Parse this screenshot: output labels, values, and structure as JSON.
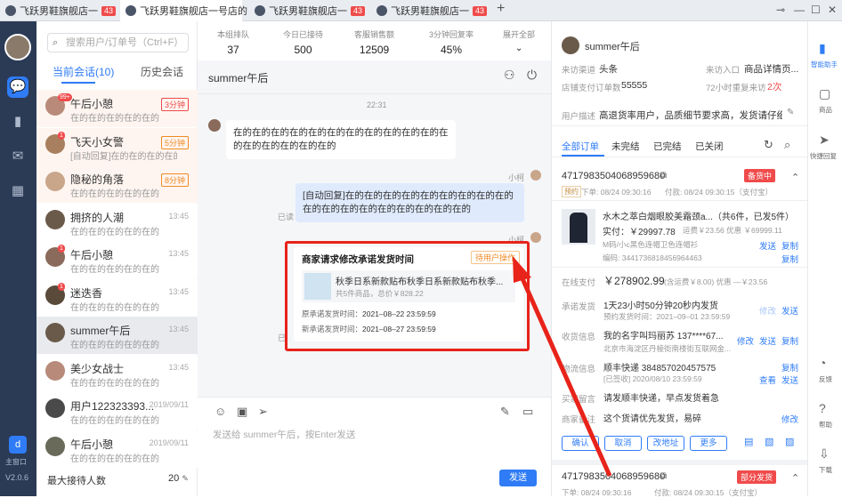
{
  "tabs": [
    {
      "label": "飞跃男鞋旗舰店一",
      "badge": "43"
    },
    {
      "label": "飞跃男鞋旗舰店一号店的"
    },
    {
      "label": "飞跃男鞋旗舰店一",
      "badge": "43"
    },
    {
      "label": "飞跃男鞋旗舰店一",
      "badge": "43"
    }
  ],
  "add_tab": "+",
  "window_controls": {
    "pin": "⊸",
    "minimize": "—",
    "maximize": "☐",
    "close": "✕"
  },
  "rail": {
    "main_label": "主窗口",
    "version": "V2.0.6"
  },
  "search": {
    "placeholder": "搜索用户/订单号（Ctrl+F）"
  },
  "conv_tabs": {
    "current": "当前会话(10)",
    "history": "历史会话"
  },
  "conversations": [
    {
      "name": "午后小憩",
      "msg": "在的在的在的在的在的",
      "time": "3分钟",
      "badge": "99+",
      "bg": "#fff5f0",
      "tcolor": "#f04b4b"
    },
    {
      "name": "飞天小女警",
      "msg": "[自动回复]在的在的在的在的",
      "time": "5分钟",
      "badge": "1",
      "bg": "#fff5f0",
      "tcolor": "#f08a24"
    },
    {
      "name": "隐秘的角落",
      "msg": "在的在的在的在的在的",
      "time": "8分钟",
      "badge": "",
      "bg": "#fff5f0",
      "tcolor": "#f08a24"
    },
    {
      "name": "拥挤的人潮",
      "msg": "在的在的在的在的在的",
      "time": "13:45",
      "badge": "",
      "bg": "#fff",
      "tcolor": ""
    },
    {
      "name": "午后小憩",
      "msg": "在的在的在的在的在的",
      "time": "13:45",
      "badge": "1",
      "bg": "#fff",
      "tcolor": ""
    },
    {
      "name": "迷迭香",
      "msg": "在的在的在的在的在的",
      "time": "13:45",
      "badge": "1",
      "bg": "#fff",
      "tcolor": ""
    },
    {
      "name": "summer午后",
      "msg": "在的在的在的在的在的",
      "time": "13:45",
      "badge": "",
      "bg": "#e8eaee",
      "tcolor": ""
    },
    {
      "name": "美少女战士",
      "msg": "在的在的在的在的在的",
      "time": "13:45",
      "badge": "",
      "bg": "#fff",
      "tcolor": ""
    },
    {
      "name": "用户122323393...",
      "msg": "在的在的在的在的在的",
      "time": "2019/09/11",
      "badge": "",
      "bg": "#fff",
      "tcolor": ""
    },
    {
      "name": "午后小憩",
      "msg": "在的在的在的在的在的",
      "time": "2019/09/11",
      "badge": "",
      "bg": "#fff",
      "tcolor": ""
    }
  ],
  "max_receive": {
    "label": "最大接待人数",
    "value": "20"
  },
  "stats": [
    {
      "label": "本组排队",
      "value": "37"
    },
    {
      "label": "今日已接待",
      "value": "500"
    },
    {
      "label": "客服销售额",
      "value": "12509"
    },
    {
      "label": "3分钟回复率",
      "value": "45%"
    }
  ],
  "expand_all": "展开全部",
  "chat": {
    "title": "summer午后",
    "time": "22:31",
    "msg_in": "在的在的在的在的在的在的在的在的在的在的在的在的在的在的在的在的在的",
    "sender1": "小柯",
    "msg_out": "[自动回复]在的在的在的在的在的在的在的在的在的在的在的在的在的在的在的在的在的在的",
    "read": "已读",
    "sender2": "小柯",
    "read2": "已",
    "card": {
      "title": "商家请求修改承诺发货时间",
      "status": "待用户操作",
      "product": "秋季日系新款贴布秋季日系新款贴布秋季...",
      "summary": "共5件商品，总价￥828.22",
      "orig_label": "原承诺发货时间：",
      "orig_value": "2021–08–22 23:59:59",
      "new_label": "新承诺发货时间：",
      "new_value": "2021–08–27 23:59:59"
    },
    "input_placeholder": "发送给 summer午后，按Enter发送",
    "send": "发送"
  },
  "customer": {
    "name": "summer午后",
    "source_label": "来访渠道",
    "source": "头条",
    "entry_label": "来访入口",
    "entry": "商品详情页...",
    "paid_label": "店铺支付订单数",
    "paid": "55555",
    "repeat_label": "72小时重复来访",
    "repeat": "2次",
    "desc_label": "用户描述",
    "desc": "高退货率用户，品质细节要求高，发货请仔细..."
  },
  "order_tabs": [
    "全部订单",
    "未完结",
    "已完结",
    "已关闭"
  ],
  "order": {
    "id": "4717983504068959680",
    "status": "备货中",
    "prepay": "预约",
    "order_time": "下单: 08/24 09:30:16",
    "pay_time": "付款: 08/24 09:30:15（支付宝）",
    "product": "水木之萃白烟眼胶美霜颈a...",
    "qty": "（共6件，已发5件）",
    "actual": "实付：￥29997.78",
    "actual_extra": "运费￥23.56 优惠 ￥69999.11",
    "sku": "M码/小c黑色连帽卫色连帽衫",
    "code": "编码: 3441736818456964463",
    "send": "发送",
    "copy": "复制",
    "online_label": "在线支付",
    "online": "￥278902.99",
    "online_extra": "(含运费￥8.00)  优惠 —￥23.56",
    "promise_label": "承诺发货",
    "promise": "1天23小时50分钟20秒内发货",
    "promise_sub": "预约发货时间：2021–09–01 23:59:59",
    "modify": "修改",
    "recv_label": "收货信息",
    "recv": "我的名字叫玛丽苏  137****67...",
    "recv_addr": "北京市海淀区丹棱街南楼街互联网金...",
    "view": "查看",
    "ship_label": "物流信息",
    "ship": "顺丰快递  384857020457575",
    "ship_sub": "[已签收] 2020/08/10 23:59:59",
    "buyer_label": "买家留言",
    "buyer": "请发顺丰快递，早点发货着急",
    "merch_label": "商家备注",
    "merch": "这个货请优先发货，易碎",
    "buttons": [
      "确认",
      "取消",
      "改地址",
      "更多"
    ]
  },
  "order2": {
    "id": "4717983504068959680",
    "status": "部分发货",
    "order_time": "下单: 08/24 09:30:16",
    "pay_time": "付款: 08/24 09:30:15（支付宝）"
  },
  "right_nav": {
    "assistant": "智能助手",
    "goods": "商品",
    "quick": "快捷回复",
    "feedback": "反馈",
    "help": "帮助",
    "download": "下载"
  },
  "colors": {
    "accent": "#2f7cf6",
    "danger": "#f04b4b",
    "rail": "#2b3a55",
    "highlight": "#e8231a"
  }
}
